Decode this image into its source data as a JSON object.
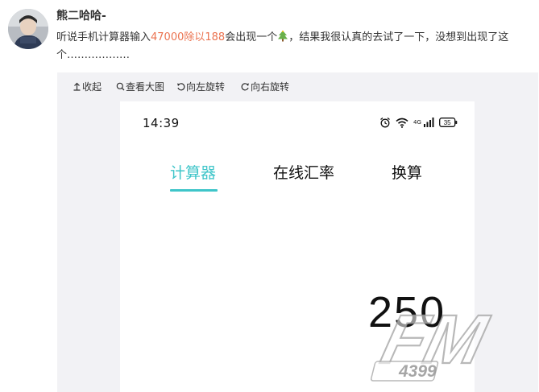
{
  "post": {
    "author": "熊二哈哈-",
    "text_before": "听说手机计算器输入",
    "text_highlight": "47000除以188",
    "text_after": "会出现一个",
    "text_tail": "，结果我很认真的去试了一下，没想到出现了这个………………"
  },
  "toolbar": {
    "collapse_label": "收起",
    "view_large_label": "查看大图",
    "rotate_left_label": "向左旋转",
    "rotate_right_label": "向右旋转"
  },
  "phone": {
    "status_time": "14:39",
    "network_label": "4G",
    "battery_level": "35",
    "tabs": [
      "计算器",
      "在线汇率",
      "换算"
    ],
    "active_tab": "计算器",
    "display_value": "250"
  },
  "watermark": {
    "logo_text": "FM",
    "logo_number": "4399"
  },
  "colors": {
    "highlight": "#eb7350",
    "accent": "#3ec5c9",
    "viewer_bg": "#f2f2f5"
  },
  "icons": [
    "avatar",
    "christmas-tree-icon",
    "collapse-icon",
    "zoom-icon",
    "rotate-left-icon",
    "rotate-right-icon",
    "alarm-icon",
    "wifi-icon",
    "signal-icon",
    "battery-icon"
  ]
}
